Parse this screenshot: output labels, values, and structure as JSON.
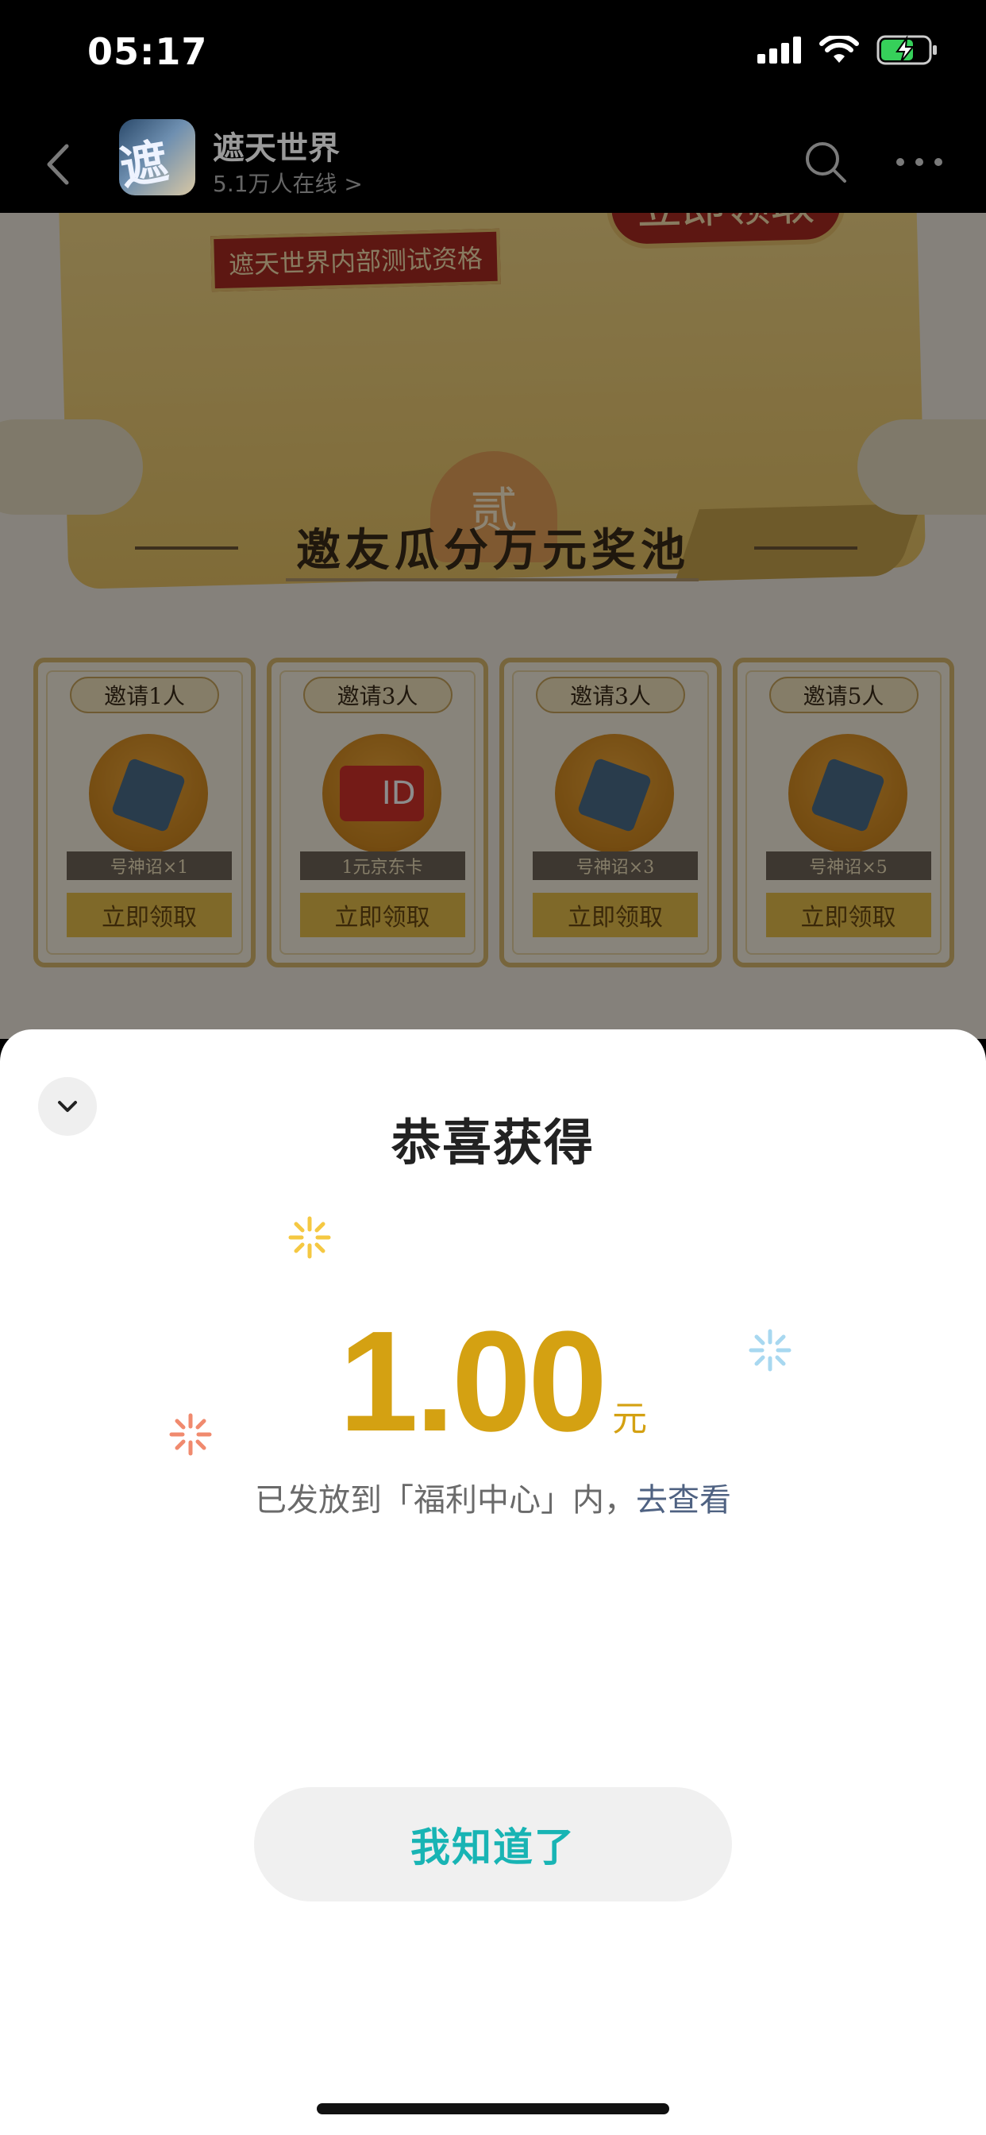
{
  "status_bar": {
    "time": "05:17"
  },
  "nav": {
    "app_icon_glyph": "遮天",
    "title": "遮天世界",
    "subtitle": "5.1万人在线 >"
  },
  "background": {
    "coupon_button": "立即领取",
    "coupon_tag": "遮天世界内部测试资格",
    "section_badge": "贰",
    "section_title": "邀友瓜分万元奖池",
    "cards": [
      {
        "label": "邀请1人",
        "prize": "号神诏×1",
        "button": "立即领取",
        "medal": "art"
      },
      {
        "label": "邀请3人",
        "prize": "1元京东卡",
        "button": "立即领取",
        "medal": "id"
      },
      {
        "label": "邀请3人",
        "prize": "号神诏×3",
        "button": "立即领取",
        "medal": "art"
      },
      {
        "label": "邀请5人",
        "prize": "号神诏×5",
        "button": "立即领取",
        "medal": "art"
      }
    ],
    "id_card_text": "ID"
  },
  "sheet": {
    "title": "恭喜获得",
    "amount": "1.00",
    "unit": "元",
    "desc_prefix": "已发放到「福利中心」内，",
    "desc_link": "去查看",
    "confirm_button": "我知道了"
  },
  "colors": {
    "amount": "#d4a112",
    "confirm_text": "#18b4b4",
    "link": "#4f6282"
  }
}
